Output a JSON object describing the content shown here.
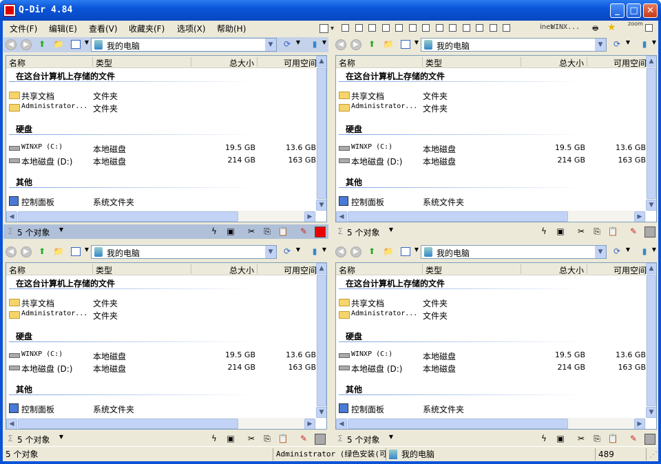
{
  "window": {
    "title": "Q-Dir 4.84",
    "min": "_",
    "max": "□",
    "close": "✕"
  },
  "menu": [
    "文件(F)",
    "编辑(E)",
    "查看(V)",
    "收藏夹(F)",
    "选项(X)",
    "帮助(H)"
  ],
  "toolbar": {
    "inet": "inet",
    "drive_label": "WINX...",
    "zoom": "zoom"
  },
  "pane": {
    "address": "我的电脑",
    "columns": [
      "名称",
      "类型",
      "总大小",
      "可用空间"
    ],
    "groups": [
      {
        "title": "在这台计算机上存储的文件",
        "items": [
          {
            "icon": "folder",
            "name": "共享文档",
            "type": "文件夹",
            "size": "",
            "free": ""
          },
          {
            "icon": "folder",
            "name": "Administrator...",
            "type": "文件夹",
            "size": "",
            "free": ""
          }
        ]
      },
      {
        "title": "硬盘",
        "items": [
          {
            "icon": "drive",
            "name": "WINXP (C:)",
            "type": "本地磁盘",
            "size": "19.5 GB",
            "free": "13.6 GB"
          },
          {
            "icon": "drive",
            "name": "本地磁盘 (D:)",
            "type": "本地磁盘",
            "size": "214 GB",
            "free": "163 GB"
          }
        ]
      },
      {
        "title": "其他",
        "items": [
          {
            "icon": "control-panel",
            "name": "控制面板",
            "type": "系统文件夹",
            "size": "",
            "free": ""
          }
        ]
      }
    ],
    "status": "5 个对象"
  },
  "panes": [
    {
      "id": "top-left",
      "active": true
    },
    {
      "id": "top-right"
    },
    {
      "id": "bottom-left"
    },
    {
      "id": "bottom-right"
    }
  ],
  "statusbar": {
    "count": "5 个对象",
    "user": "Administrator (绿色安装(可",
    "location": "我的电脑",
    "number": "489"
  }
}
